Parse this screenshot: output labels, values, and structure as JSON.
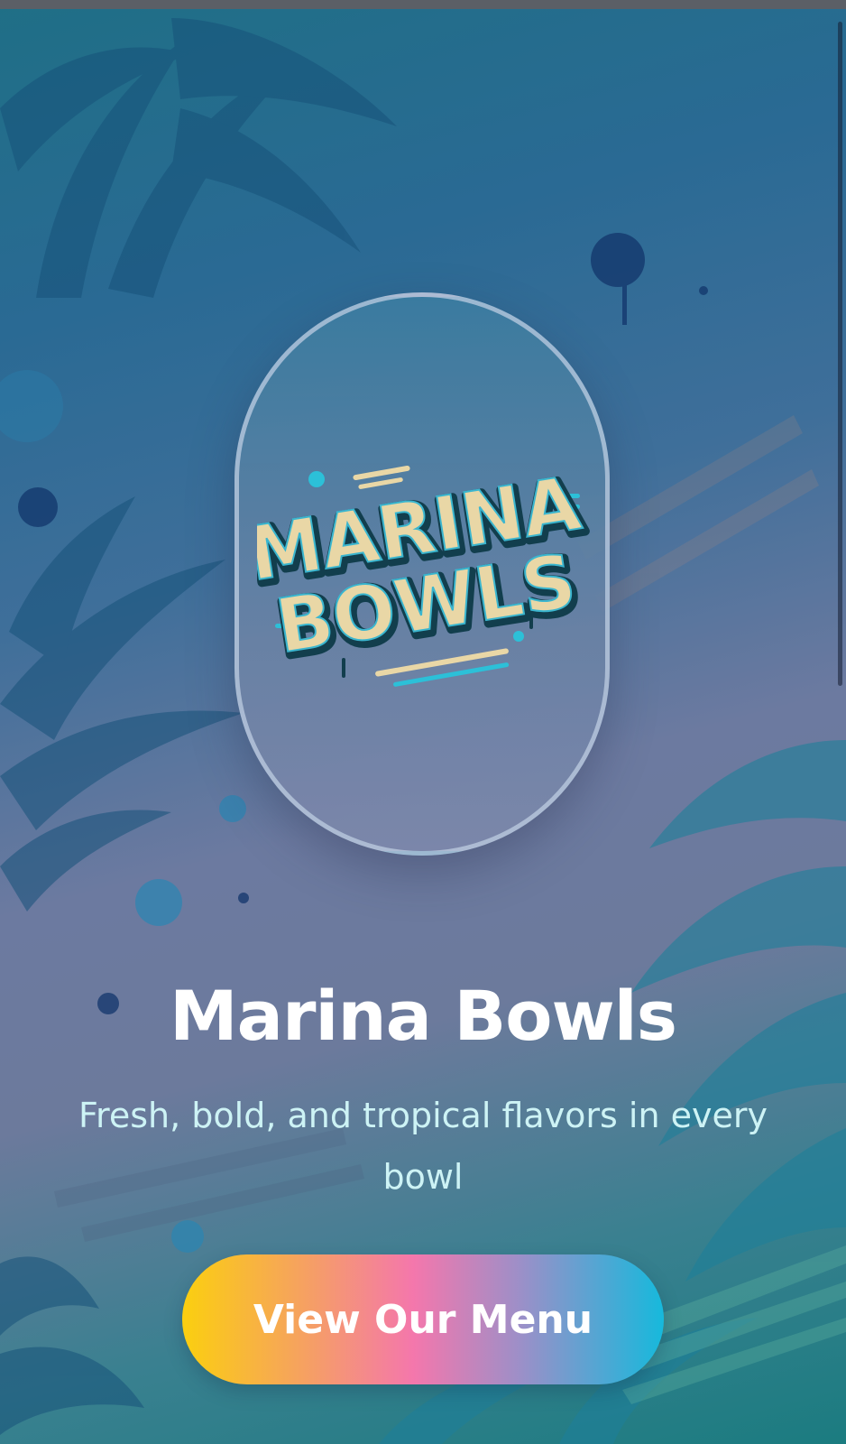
{
  "brand": {
    "logo_line1": "MARINA",
    "logo_line2": "BOWLS"
  },
  "hero": {
    "title": "Marina Bowls",
    "tagline": "Fresh, bold, and tropical flavors in every bowl"
  },
  "cta": {
    "label": "View Our Menu"
  },
  "colors": {
    "accent_yellow": "#fbcf0f",
    "accent_pink": "#f477ac",
    "accent_cyan": "#16b9dc",
    "title_text": "#ffffff",
    "tagline_text": "#cdf3f5"
  },
  "icons": [
    "palm-leaf-decoration",
    "paint-splatter-decoration"
  ]
}
